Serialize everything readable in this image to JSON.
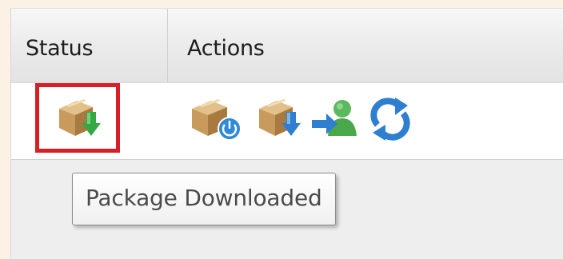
{
  "grid": {
    "columns": [
      {
        "label": "Status"
      },
      {
        "label": "Actions"
      }
    ]
  },
  "row": {
    "status_icon": "package-downloaded-icon",
    "actions": [
      {
        "icon": "package-install-icon"
      },
      {
        "icon": "package-download-icon"
      },
      {
        "icon": "assign-user-icon"
      },
      {
        "icon": "refresh-icon"
      }
    ]
  },
  "tooltip": {
    "text": "Package Downloaded"
  },
  "colors": {
    "highlight": "#d42026",
    "box": "#c9a06a",
    "green_arrow": "#35a844",
    "blue_arrow": "#2f7fd0"
  }
}
